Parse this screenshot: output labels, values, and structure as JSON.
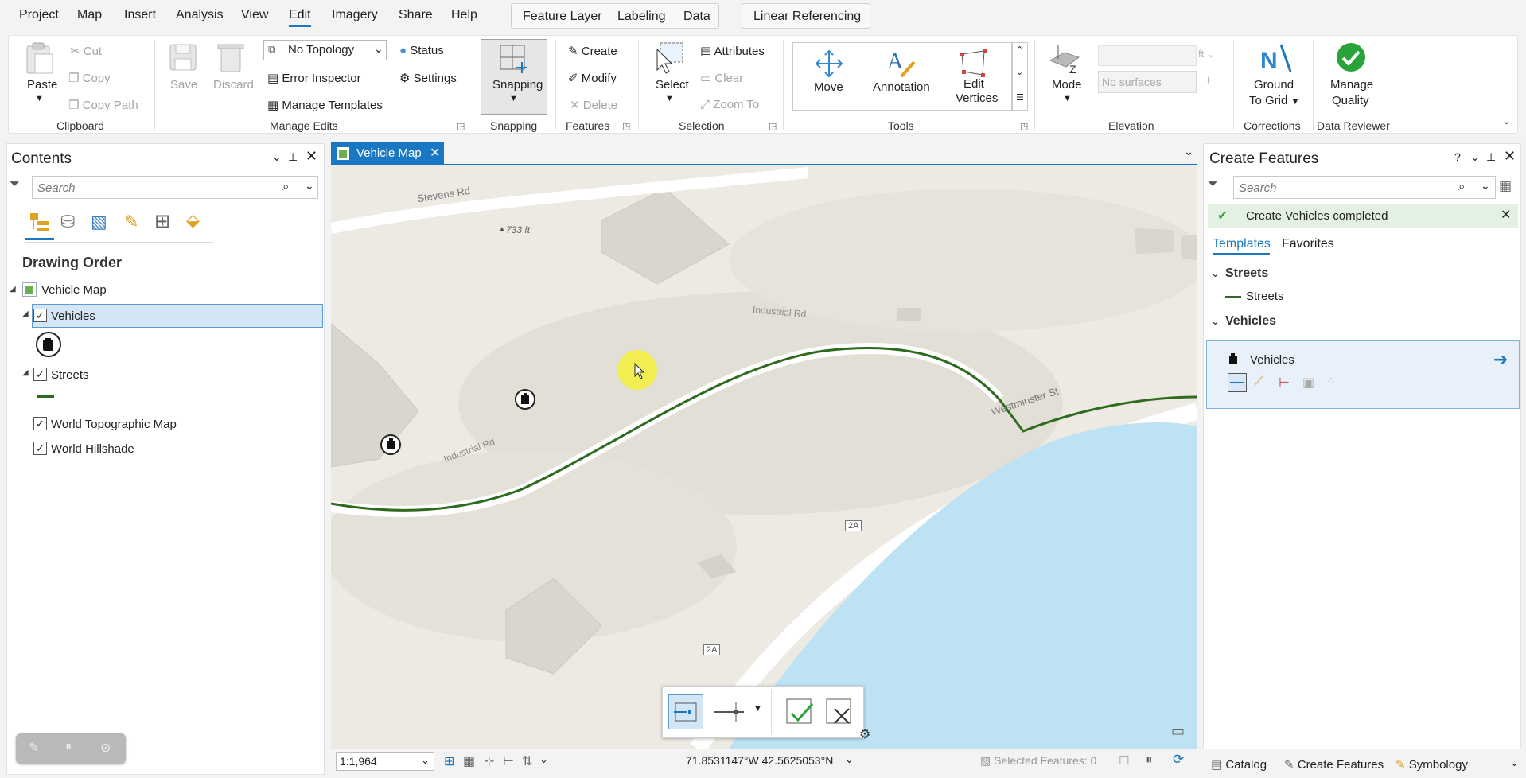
{
  "menu": {
    "items": [
      "Project",
      "Map",
      "Insert",
      "Analysis",
      "View",
      "Edit",
      "Imagery",
      "Share",
      "Help"
    ],
    "active": "Edit",
    "contextual_tabs": [
      "Feature Layer",
      "Labeling",
      "Data"
    ],
    "linear_tab": "Linear Referencing"
  },
  "ribbon": {
    "clipboard": {
      "paste": "Paste",
      "cut": "Cut",
      "copy": "Copy",
      "copy_path": "Copy Path",
      "group": "Clipboard"
    },
    "manage_edits": {
      "save": "Save",
      "discard": "Discard",
      "topology_value": "No Topology",
      "status": "Status",
      "error_inspector": "Error Inspector",
      "settings": "Settings",
      "manage_templates": "Manage Templates",
      "group": "Manage Edits"
    },
    "snapping": {
      "label": "Snapping",
      "group": "Snapping"
    },
    "features": {
      "create": "Create",
      "modify": "Modify",
      "delete": "Delete",
      "group": "Features"
    },
    "selection": {
      "select": "Select",
      "attributes": "Attributes",
      "clear": "Clear",
      "zoom_to": "Zoom To",
      "group": "Selection"
    },
    "tools": {
      "move": "Move",
      "annotation": "Annotation",
      "edit_vertices_1": "Edit",
      "edit_vertices_2": "Vertices",
      "group": "Tools"
    },
    "elevation": {
      "mode": "Mode",
      "unit": "ft",
      "surfaces": "No surfaces",
      "group": "Elevation"
    },
    "corrections": {
      "ground_1": "Ground",
      "ground_2": "To Grid",
      "group": "Corrections"
    },
    "data_reviewer": {
      "manage_1": "Manage",
      "manage_2": "Quality",
      "group": "Data Reviewer"
    }
  },
  "contents": {
    "title": "Contents",
    "search_placeholder": "Search",
    "heading": "Drawing Order",
    "map_name": "Vehicle Map",
    "layers": [
      "Vehicles",
      "Streets",
      "World Topographic Map",
      "World Hillshade"
    ]
  },
  "map": {
    "tab_title": "Vehicle Map",
    "labels": {
      "stevens": "Stevens Rd",
      "elevation": "733 ft",
      "industrial_top": "Industrial Rd",
      "industrial_low": "Industrial Rd",
      "westminster": "Westminster St",
      "shield_1": "2A",
      "shield_2": "2A"
    },
    "scale": "1:1,964",
    "coordinates": "71.8531147°W 42.5625053°N",
    "selected_features": "Selected Features: 0"
  },
  "create_features": {
    "title": "Create Features",
    "search_placeholder": "Search",
    "message": "Create Vehicles completed",
    "tabs": [
      "Templates",
      "Favorites"
    ],
    "groups": [
      {
        "name": "Streets",
        "template": "Streets"
      },
      {
        "name": "Vehicles",
        "template": "Vehicles"
      }
    ]
  },
  "bottom_tabs": [
    "Catalog",
    "Create Features",
    "Symbology"
  ],
  "colors": {
    "accent": "#1a78c2",
    "street_line": "#2e6b1e",
    "water": "#bde2f4",
    "success": "#2aa33b",
    "cursor_highlight": "#f5f03a"
  }
}
